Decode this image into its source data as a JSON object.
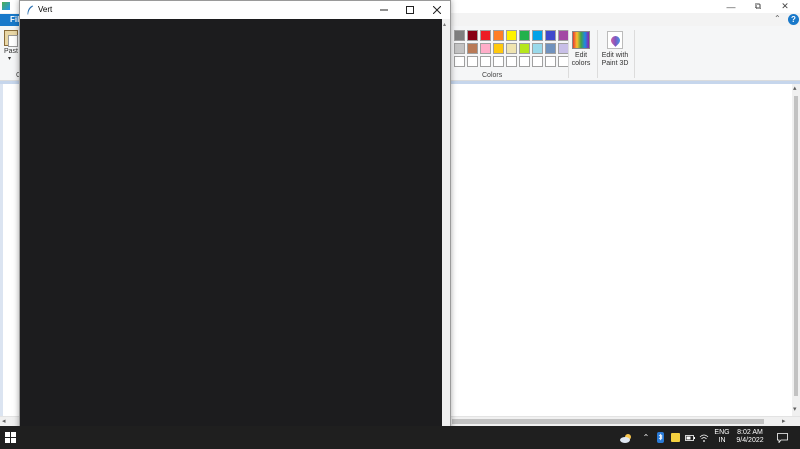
{
  "paint": {
    "file_tab": "Fil",
    "paste_label": "Past",
    "group_letter": "C",
    "colors_group_label": "Colors",
    "edit_colors_line1": "Edit",
    "edit_colors_line2": "colors",
    "paint3d_line1": "Edit with",
    "paint3d_line2": "Paint 3D",
    "help_glyph": "?",
    "palette_row1": [
      "#7f7f7f",
      "#880015",
      "#ed1c24",
      "#ff7f27",
      "#fff200",
      "#22b14c",
      "#00a2e8",
      "#3f48cc",
      "#a349a4"
    ],
    "palette_row2": [
      "#c3c3c3",
      "#b97a57",
      "#ffaec9",
      "#ffc90e",
      "#efe4b0",
      "#b5e61d",
      "#99d9ea",
      "#7092be",
      "#c8bfe7"
    ],
    "palette_row3": [
      "#ffffff",
      "#ffffff",
      "#ffffff",
      "#ffffff",
      "#ffffff",
      "#ffffff",
      "#ffffff",
      "#ffffff",
      "#ffffff"
    ]
  },
  "vert": {
    "title": "Vert",
    "content_color": "#1c1c1e"
  },
  "taskbar": {
    "lang_line1": "ENG",
    "lang_line2": "IN",
    "time": "8:02 AM",
    "date": "9/4/2022"
  }
}
